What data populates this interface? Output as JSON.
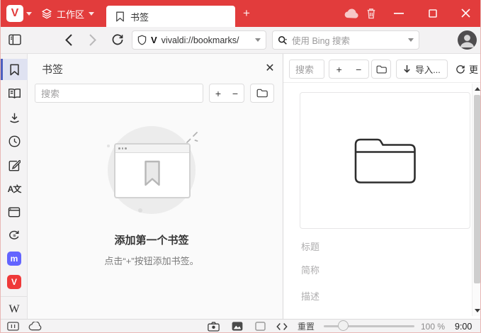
{
  "titlebar": {
    "logo_glyph": "V",
    "workspace_label": "工作区",
    "tab_label": "书签",
    "new_tab_label": "+"
  },
  "addressbar": {
    "v_badge_glyph": "V",
    "url": "vivaldi://bookmarks/",
    "search_placeholder": "使用 Bing 搜索"
  },
  "sidebar": {
    "translate_glyph": "A文",
    "mastodon_glyph": "m",
    "vivaldi_glyph": "V",
    "wikipedia_glyph": "W"
  },
  "panel": {
    "title": "书签",
    "close_glyph": "✕",
    "search_placeholder": "搜索",
    "add_label": "+",
    "remove_label": "−",
    "empty_heading": "添加第一个书签",
    "empty_subtext": "点击“+”按钮添加书签。"
  },
  "page": {
    "search_placeholder": "搜索",
    "add_label": "+",
    "remove_label": "−",
    "import_label": "导入...",
    "update_label_truncated": "更",
    "title_placeholder": "标题",
    "nickname_placeholder": "简称",
    "description_placeholder": "描述"
  },
  "statusbar": {
    "reset_label": "重置",
    "zoom_value": "100 %",
    "time": "9:00"
  },
  "colors": {
    "accent_red": "#e23c3c",
    "panel_active_bg": "#dfe2f1",
    "panel_active_bar": "#4d5fc0",
    "mastodon_purple": "#6364ff",
    "vivaldi_red": "#ef3939"
  }
}
